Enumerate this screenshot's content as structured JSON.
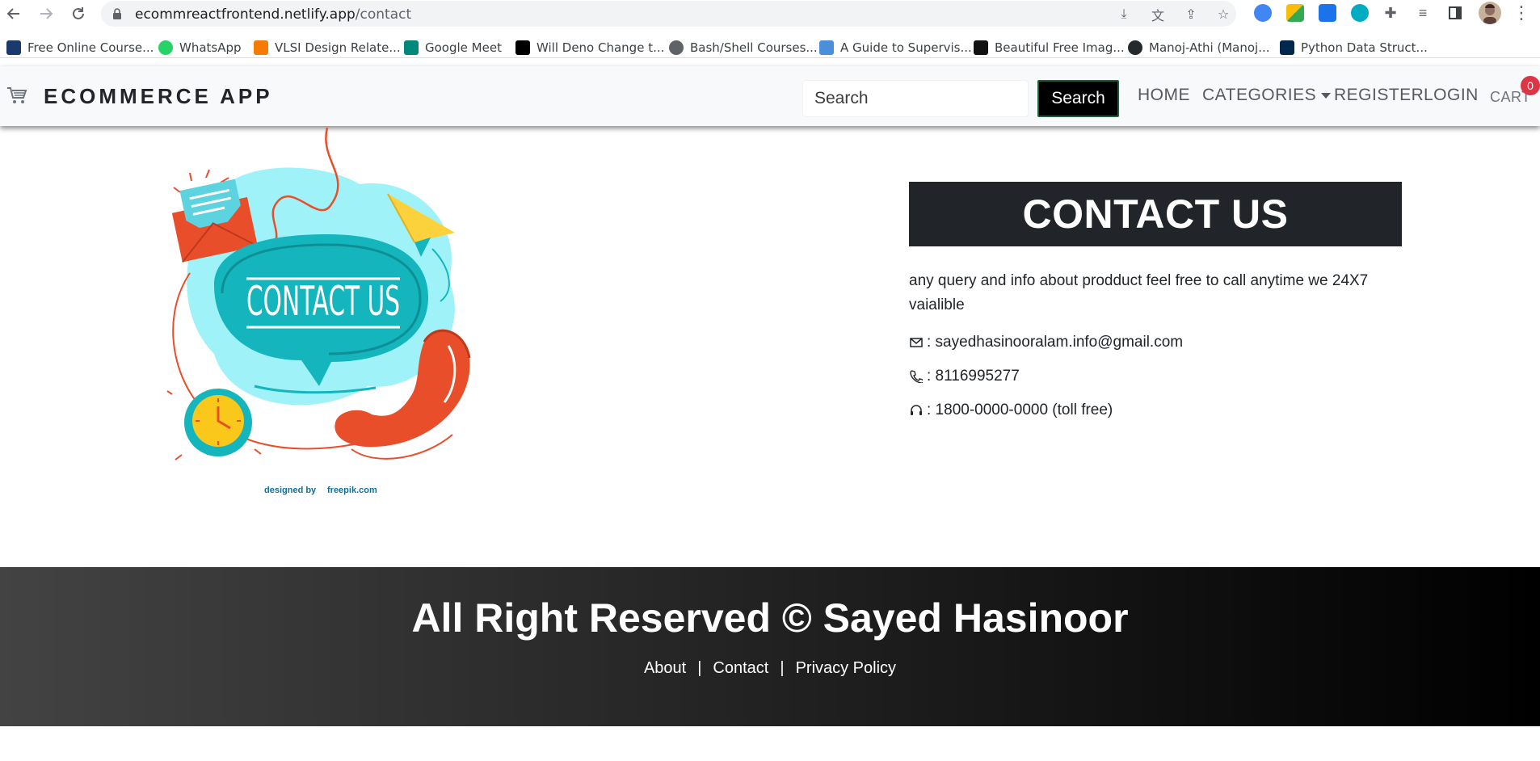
{
  "browser": {
    "url_host": "ecommreactfrontend.netlify.app",
    "url_path": "/contact",
    "nav_icons": [
      "back-icon",
      "forward-icon",
      "reload-icon"
    ],
    "bookmarks": [
      {
        "label": "Free Online Course...",
        "color": "#1a3a6e"
      },
      {
        "label": "WhatsApp",
        "color": "#25d366"
      },
      {
        "label": "VLSI Design Relate...",
        "color": "#f57c00"
      },
      {
        "label": "Google Meet",
        "color": "#00897b"
      },
      {
        "label": "Will Deno Change t...",
        "color": "#000000"
      },
      {
        "label": "Bash/Shell Courses...",
        "color": "#5f6368"
      },
      {
        "label": "A Guide to Supervis...",
        "color": "#4a90d9"
      },
      {
        "label": "Beautiful Free Imag...",
        "color": "#111111"
      },
      {
        "label": "Manoj-Athi (Manoj...",
        "color": "#24292e"
      },
      {
        "label": "Python Data Struct...",
        "color": "#00274c"
      }
    ]
  },
  "navbar": {
    "brand": "ECOMMERCE APP",
    "search_placeholder": "Search",
    "search_button": "Search",
    "links": {
      "home": "HOME",
      "categories": "CATEGORIES",
      "register": "REGISTER",
      "login": "LOGIN",
      "cart": "CART"
    },
    "cart_count": "0"
  },
  "illustration": {
    "bubble_text": "CONTACT US",
    "credit_prefix": "designed by",
    "credit_brand": "freepik.com"
  },
  "contact": {
    "heading": "CONTACT US",
    "description": "any query and info about prodduct feel free to call anytime we 24X7 vaialible",
    "email": " : sayedhasinooralam.info@gmail.com",
    "phone": " : 8116995277",
    "tollfree": " : 1800-0000-0000 (toll free)"
  },
  "footer": {
    "title": "All Right Reserved © Sayed Hasinoor",
    "links": {
      "about": "About",
      "contact": "Contact",
      "privacy": "Privacy Policy"
    },
    "separator": "|"
  },
  "colors": {
    "heading_bg": "#212529",
    "search_btn_bg": "#000000",
    "badge": "#dc3545",
    "illustration_teal": "#14b5bd",
    "illustration_light": "#9ff3f8",
    "phone_red": "#e94e2b",
    "clock_yellow": "#f9c81a"
  }
}
